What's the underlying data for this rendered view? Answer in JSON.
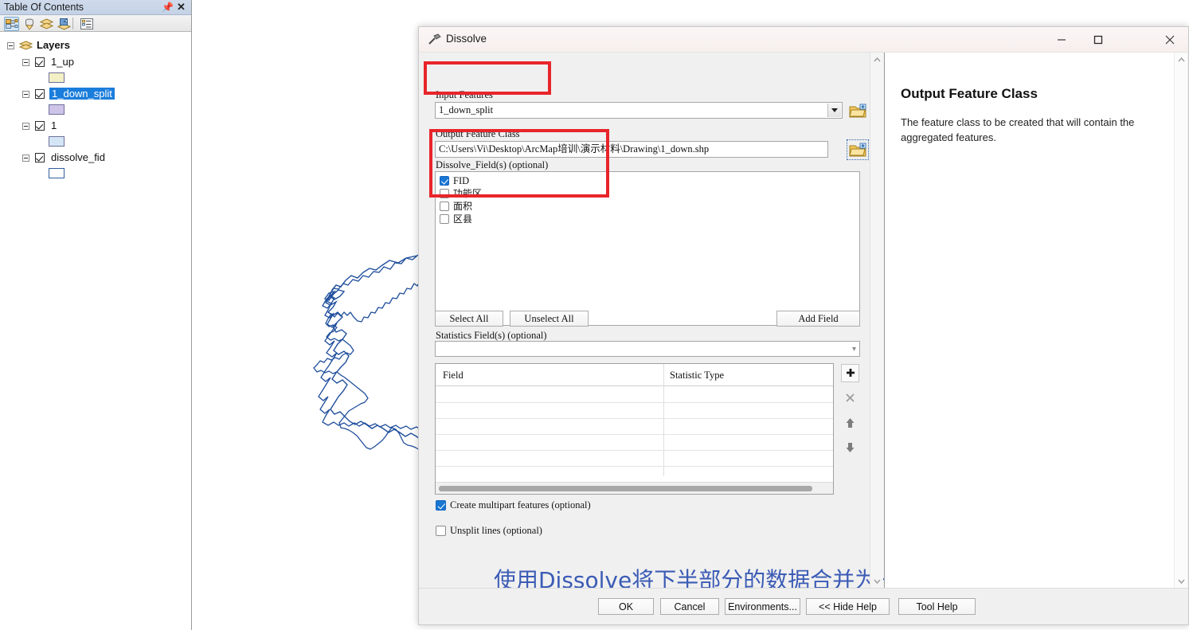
{
  "toc": {
    "title": "Table Of Contents",
    "pin_icon": "pin-icon",
    "close_icon": "close-icon",
    "toolbar": [
      {
        "name": "list-by-drawing-order-icon",
        "selected": true
      },
      {
        "name": "list-by-source-icon",
        "selected": false
      },
      {
        "name": "list-by-visibility-icon",
        "selected": false
      },
      {
        "name": "list-by-selection-icon",
        "selected": false
      },
      {
        "name": "options-icon",
        "selected": false
      }
    ],
    "root_label": "Layers",
    "layers": [
      {
        "label": "1_up",
        "checked": true,
        "selected": false,
        "swatch": "#f2f0c4"
      },
      {
        "label": "1_down_split",
        "checked": true,
        "selected": true,
        "swatch": "#cdc4e8"
      },
      {
        "label": "1",
        "checked": true,
        "selected": false,
        "swatch": "#d4e6f5"
      },
      {
        "label": "dissolve_fid",
        "checked": true,
        "selected": false,
        "swatch": "#ffffff"
      }
    ]
  },
  "map": {
    "outline_color": "#1f4e9c"
  },
  "dialog": {
    "title": "Dissolve",
    "icon": "hammer-tool-icon",
    "window_buttons": {
      "minimize": "—",
      "maximize": "□",
      "close": "✕"
    },
    "input_features": {
      "label": "Input Features",
      "value": "1_down_split",
      "browse_icon": "open-folder-icon",
      "dropdown_icon": "chevron-down-icon"
    },
    "output_feature_class": {
      "label": "Output Feature Class",
      "value": "C:\\Users\\Vi\\Desktop\\ArcMap培训\\演示材料\\Drawing\\1_down.shp",
      "browse_icon": "open-folder-icon"
    },
    "dissolve_fields": {
      "label": "Dissolve_Field(s) (optional)",
      "items": [
        {
          "label": "FID",
          "checked": true,
          "chinese": false
        },
        {
          "label": "功能区",
          "checked": false,
          "chinese": true
        },
        {
          "label": "面积",
          "checked": false,
          "chinese": true
        },
        {
          "label": "区县",
          "checked": false,
          "chinese": true
        }
      ]
    },
    "field_buttons": {
      "select_all": "Select All",
      "unselect_all": "Unselect All",
      "add_field": "Add Field"
    },
    "statistics_fields": {
      "label": "Statistics Field(s) (optional)",
      "value": "",
      "dropdown_icon": "chevron-down-icon"
    },
    "grid": {
      "columns": [
        "Field",
        "Statistic Type"
      ],
      "rows": []
    },
    "grid_buttons": [
      {
        "name": "add-row-button",
        "glyph": "✚",
        "enabled": true
      },
      {
        "name": "remove-row-button",
        "glyph": "✕",
        "enabled": false
      },
      {
        "name": "move-up-button",
        "glyph": "↑",
        "enabled": true
      },
      {
        "name": "move-down-button",
        "glyph": "↓",
        "enabled": true
      }
    ],
    "options": [
      {
        "label": "Create multipart features (optional)",
        "checked": true
      },
      {
        "label": "Unsplit lines (optional)",
        "checked": false
      }
    ],
    "annotation": "使用Dissolve将下半部分的数据合并为一个数据",
    "buttons": {
      "ok": "OK",
      "cancel": "Cancel",
      "environments": "Environments...",
      "hide_help": "<< Hide Help",
      "tool_help": "Tool Help"
    },
    "help": {
      "title": "Output Feature Class",
      "text": "The feature class to be created that will contain the aggregated features."
    }
  },
  "colors": {
    "highlight_red": "#e8252a",
    "selection_blue": "#1a7ddb",
    "annotation_blue": "#3b5bb5",
    "checkbox_blue": "#1976d2"
  }
}
